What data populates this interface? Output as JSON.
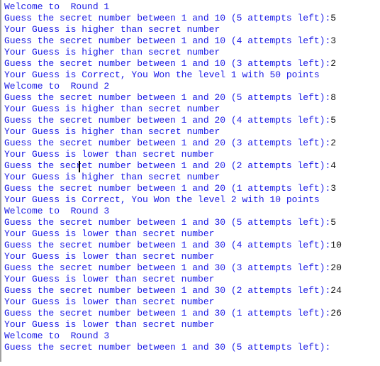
{
  "console": {
    "colors": {
      "output": "#1a1ae6",
      "input": "#111111"
    },
    "lines": [
      {
        "text": "Welcome to  Round 1",
        "input": ""
      },
      {
        "text": "Guess the secret number between 1 and 10 (5 attempts left):",
        "input": "5"
      },
      {
        "text": "Your Guess is higher than secret number",
        "input": ""
      },
      {
        "text": "Guess the secret number between 1 and 10 (4 attempts left):",
        "input": "3"
      },
      {
        "text": "Your Guess is higher than secret number",
        "input": ""
      },
      {
        "text": "Guess the secret number between 1 and 10 (3 attempts left):",
        "input": "2"
      },
      {
        "text": "Your Guess is Correct, You Won the level 1 with 50 points",
        "input": ""
      },
      {
        "text": "Welcome to  Round 2",
        "input": ""
      },
      {
        "text": "Guess the secret number between 1 and 20 (5 attempts left):",
        "input": "8"
      },
      {
        "text": "Your Guess is higher than secret number",
        "input": ""
      },
      {
        "text": "Guess the secret number between 1 and 20 (4 attempts left):",
        "input": "5"
      },
      {
        "text": "Your Guess is higher than secret number",
        "input": ""
      },
      {
        "text": "Guess the secret number between 1 and 20 (3 attempts left):",
        "input": "2"
      },
      {
        "text": "Your Guess is lower than secret number",
        "input": ""
      },
      {
        "text": "Guess the secret number between 1 and 20 (2 attempts left):",
        "input": "4"
      },
      {
        "text": "Your Guess is higher than secret number",
        "input": ""
      },
      {
        "text": "Guess the secret number between 1 and 20 (1 attempts left):",
        "input": "3"
      },
      {
        "text": "Your Guess is Correct, You Won the level 2 with 10 points",
        "input": ""
      },
      {
        "text": "Welcome to  Round 3",
        "input": ""
      },
      {
        "text": "Guess the secret number between 1 and 30 (5 attempts left):",
        "input": "5"
      },
      {
        "text": "Your Guess is lower than secret number",
        "input": ""
      },
      {
        "text": "Guess the secret number between 1 and 30 (4 attempts left):",
        "input": "10"
      },
      {
        "text": "Your Guess is lower than secret number",
        "input": ""
      },
      {
        "text": "Guess the secret number between 1 and 30 (3 attempts left):",
        "input": "20"
      },
      {
        "text": "Your Guess is lower than secret number",
        "input": ""
      },
      {
        "text": "Guess the secret number between 1 and 30 (2 attempts left):",
        "input": "24"
      },
      {
        "text": "Your Guess is lower than secret number",
        "input": ""
      },
      {
        "text": "Guess the secret number between 1 and 30 (1 attempts left):",
        "input": "26"
      },
      {
        "text": "Your Guess is lower than secret number",
        "input": ""
      },
      {
        "text": "Welcome to  Round 3",
        "input": ""
      },
      {
        "text": "Guess the secret number between 1 and 30 (5 attempts left):",
        "input": ""
      }
    ]
  }
}
